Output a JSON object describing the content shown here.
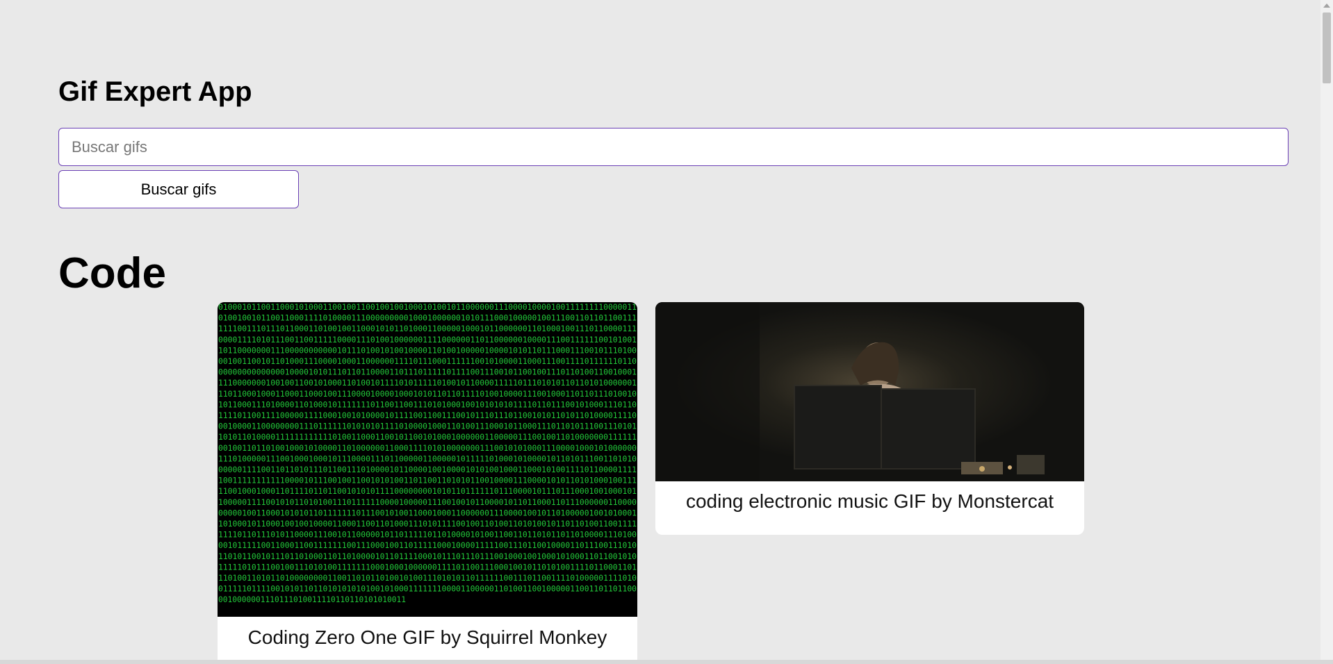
{
  "app": {
    "title": "Gif Expert App"
  },
  "search": {
    "placeholder": "Buscar gifs",
    "value": "",
    "button_label": "Buscar gifs"
  },
  "category": {
    "title": "Code",
    "gifs": [
      {
        "title": "Coding Zero One GIF by Squirrel Monkey"
      },
      {
        "title": "coding electronic music GIF by Monstercat"
      }
    ]
  },
  "colors": {
    "background": "#e9e9e9",
    "accent_border": "#6a3fb5",
    "card_bg": "#ffffff",
    "binary_green": "#22c93a"
  }
}
